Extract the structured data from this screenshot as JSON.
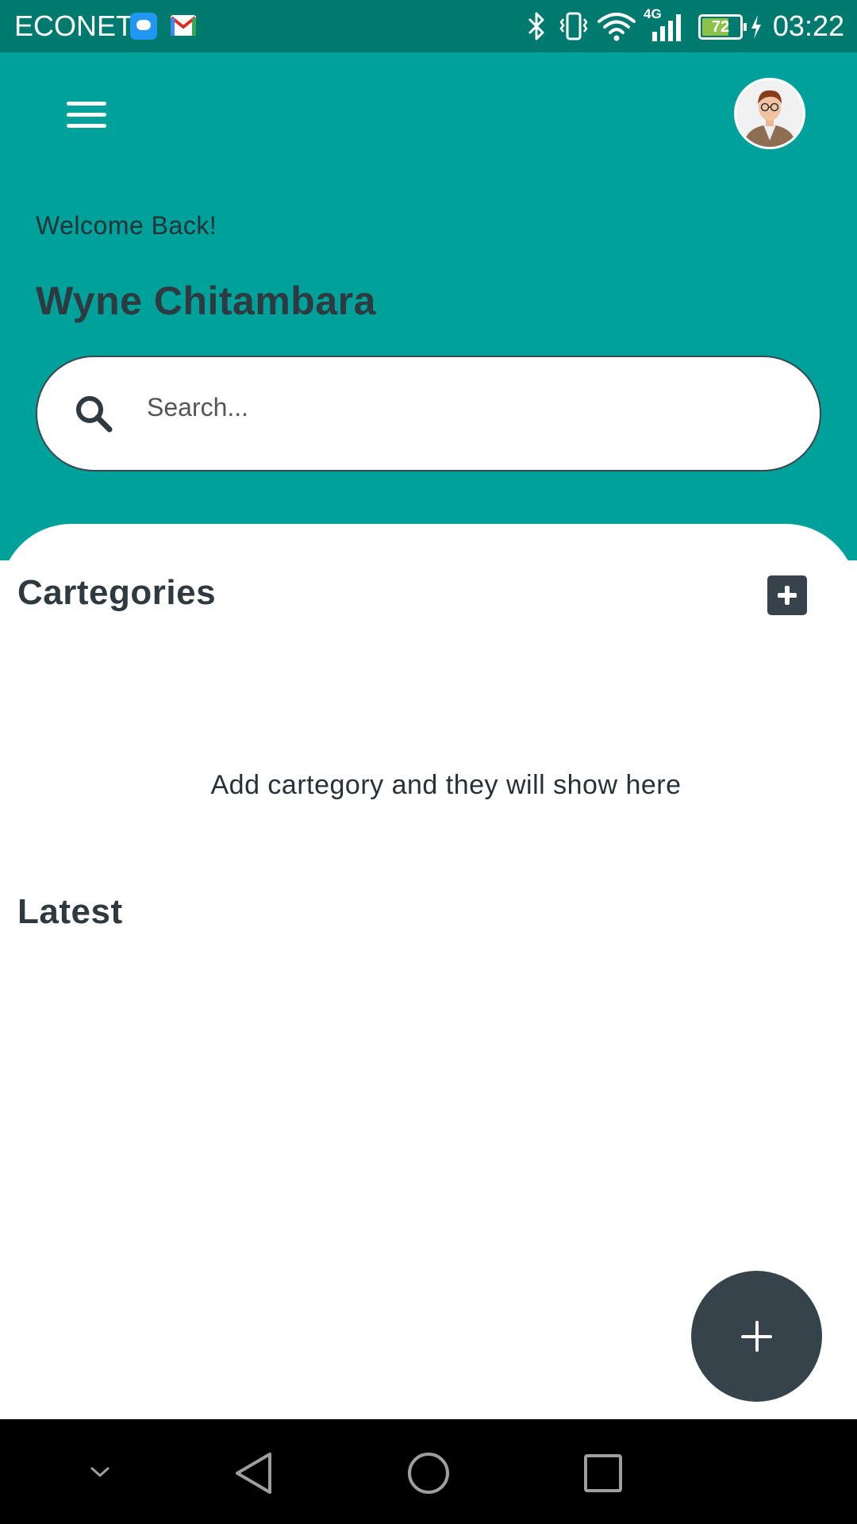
{
  "status_bar": {
    "carrier": "ECONET",
    "network_type": "4G",
    "battery_level": "72",
    "time": "03:22",
    "icons": [
      "message-icon",
      "gmail-icon",
      "bluetooth-icon",
      "vibrate-icon",
      "wifi-icon",
      "signal-icon",
      "battery-icon",
      "charging-icon"
    ]
  },
  "header": {
    "menu_icon": "hamburger-menu-icon",
    "avatar": "user-avatar",
    "welcome": "Welcome Back!",
    "user_name": "Wyne Chitambara"
  },
  "search": {
    "icon": "search-icon",
    "placeholder": "Search..."
  },
  "categories": {
    "title": "Cartegories",
    "add_icon": "add-square-icon",
    "empty_message": "Add cartegory and they will show here"
  },
  "latest": {
    "title": "Latest"
  },
  "fab": {
    "icon": "plus-icon"
  },
  "nav_bar": {
    "icons": [
      "hide-keyboard-icon",
      "back-icon",
      "home-icon",
      "recents-icon"
    ]
  },
  "colors": {
    "status_bar": "#00796f",
    "header": "#00a19a",
    "dark": "#37434a",
    "text_dark": "#2f3a40",
    "battery_fill": "#8bc34a"
  }
}
